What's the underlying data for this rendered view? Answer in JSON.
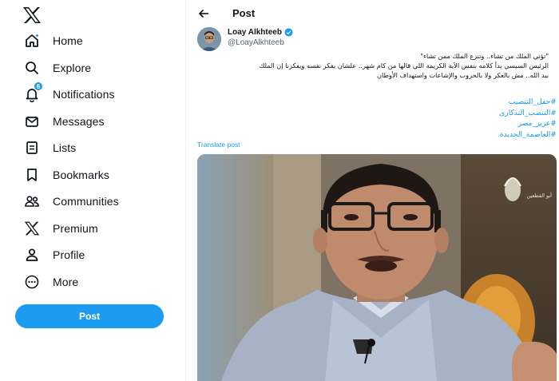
{
  "sidebar": {
    "logo": "x-logo-icon",
    "items": [
      {
        "label": "Home",
        "icon": "home-icon"
      },
      {
        "label": "Explore",
        "icon": "search-icon"
      },
      {
        "label": "Notifications",
        "icon": "bell-icon",
        "badge": "6"
      },
      {
        "label": "Messages",
        "icon": "envelope-icon"
      },
      {
        "label": "Lists",
        "icon": "list-icon"
      },
      {
        "label": "Bookmarks",
        "icon": "bookmark-icon"
      },
      {
        "label": "Communities",
        "icon": "people-icon"
      },
      {
        "label": "Premium",
        "icon": "x-logo-icon"
      },
      {
        "label": "Profile",
        "icon": "person-icon"
      },
      {
        "label": "More",
        "icon": "more-circle-icon"
      }
    ],
    "post_button": "Post"
  },
  "header": {
    "title": "Post",
    "back_icon": "arrow-left-icon"
  },
  "tweet": {
    "author_name": "Loay Alkhteeb",
    "author_handle": "@LoayAlkhteeb",
    "text_line1": "\"تؤتي الملك من تشاء.. وتنزع الملك ممن تشاء\"",
    "text_line2": "الرئيس السيسي بدأ كلامه بنفس الآية الكريمة اللي قالها من كام شهر.. علشان يفكر نفسه ويفكرنا إن الملك",
    "text_line3": "بيد الله.. مش بالعكر ولا بالحروب والإشاعات واستهداف الأوطان",
    "hashtags": [
      "#حفل_التنصيب",
      "#التنصب_التذكارى",
      "#عزيز_مصر",
      "#العاصمة_الجديدة"
    ],
    "translate_label": "Translate post",
    "media_watermark": "أبو القطعين"
  },
  "colors": {
    "accent": "#1d9bf0",
    "text": "#0f1419",
    "muted": "#536471"
  }
}
